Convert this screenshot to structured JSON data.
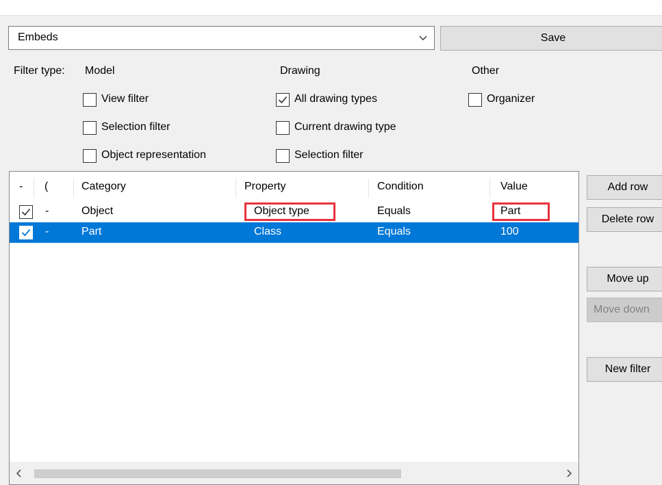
{
  "toolbar": {
    "filter_select": "Embeds",
    "save_label": "Save"
  },
  "filter_type": {
    "label": "Filter type:",
    "model_heading": "Model",
    "drawing_heading": "Drawing",
    "other_heading": "Other",
    "model_options": [
      {
        "label": "View filter",
        "checked": false
      },
      {
        "label": "Selection filter",
        "checked": false
      },
      {
        "label": "Object representation",
        "checked": false
      }
    ],
    "drawing_options": [
      {
        "label": "All drawing types",
        "checked": true
      },
      {
        "label": "Current drawing type",
        "checked": false
      },
      {
        "label": "Selection filter",
        "checked": false
      }
    ],
    "other_options": [
      {
        "label": "Organizer",
        "checked": false
      }
    ]
  },
  "grid": {
    "columns": [
      "-",
      "(",
      "Category",
      "Property",
      "Condition",
      "Value"
    ],
    "rows": [
      {
        "enabled": true,
        "paren": "-",
        "category": "Object",
        "property": "Object type",
        "condition": "Equals",
        "value": "Part",
        "selected": false
      },
      {
        "enabled": true,
        "paren": "-",
        "category": "Part",
        "property": "Class",
        "condition": "Equals",
        "value": "100",
        "selected": true
      }
    ]
  },
  "side_buttons": {
    "add_row": "Add row",
    "delete_row": "Delete row",
    "move_up": "Move up",
    "move_down": "Move down",
    "new_filter": "New filter"
  },
  "colors": {
    "selection": "#0078d7",
    "highlight": "#e8323a"
  }
}
